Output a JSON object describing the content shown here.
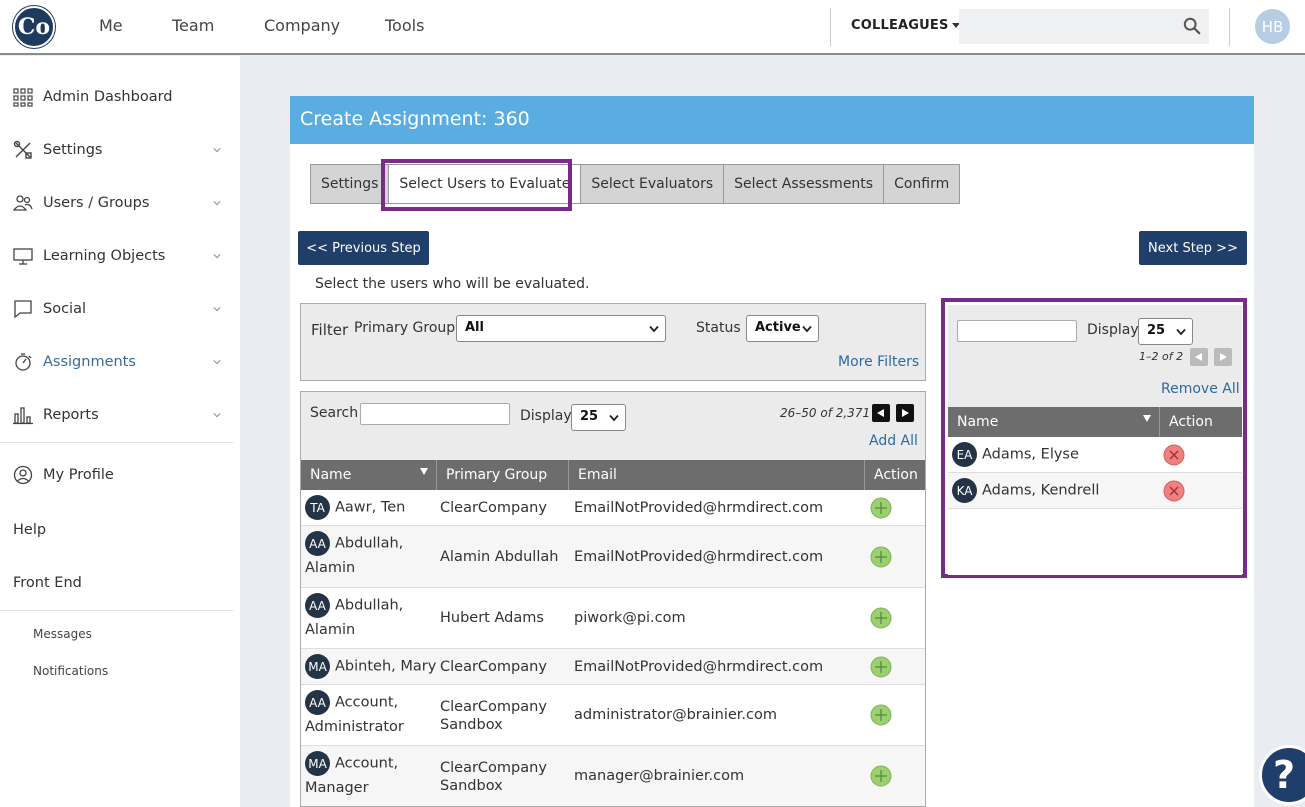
{
  "topnav": {
    "logo_text": "Co",
    "items": [
      "Me",
      "Team",
      "Company",
      "Tools"
    ],
    "colleagues_label": "COLLEAGUES",
    "search_placeholder": "",
    "user_initials": "HB"
  },
  "sidebar": {
    "items": [
      {
        "label": "Admin Dashboard",
        "icon": "grid-icon"
      },
      {
        "label": "Settings",
        "icon": "tools-icon"
      },
      {
        "label": "Users / Groups",
        "icon": "users-icon"
      },
      {
        "label": "Learning Objects",
        "icon": "monitor-icon"
      },
      {
        "label": "Social",
        "icon": "chat-icon"
      },
      {
        "label": "Assignments",
        "icon": "stopwatch-icon"
      },
      {
        "label": "Reports",
        "icon": "bar-chart-icon"
      }
    ],
    "profile_label": "My Profile",
    "help_label": "Help",
    "front_end_label": "Front End",
    "messages_label": "Messages",
    "notifications_label": "Notifications"
  },
  "card": {
    "title": "Create Assignment: 360",
    "tabs": [
      "Settings",
      "Select Users to Evaluate",
      "Select Evaluators",
      "Select Assessments",
      "Confirm"
    ],
    "active_tab": "Select Users to Evaluate",
    "prev_button": "<< Previous Step",
    "next_button": "Next Step >>",
    "instructions": "Select the users who will be evaluated."
  },
  "filter": {
    "label": "Filter",
    "primary_group_label": "Primary Group",
    "primary_group_value": "All",
    "status_label": "Status",
    "status_value": "Active",
    "more_filters": "More Filters"
  },
  "available": {
    "search_label": "Search",
    "display_label": "Display",
    "display_value": "25",
    "pager_text": "26–50 of 2,371",
    "add_all": "Add All",
    "columns": [
      "Name",
      "Primary Group",
      "Email",
      "Action"
    ],
    "rows": [
      {
        "initials": "TA",
        "name": "Aawr, Ten",
        "group": "ClearCompany",
        "email": "EmailNotProvided@hrmdirect.com"
      },
      {
        "initials": "AA",
        "name": "Abdullah, Alamin",
        "group": "Alamin Abdullah",
        "email": "EmailNotProvided@hrmdirect.com"
      },
      {
        "initials": "AA",
        "name": "Abdullah, Alamin",
        "group": "Hubert Adams",
        "email": "piwork@pi.com"
      },
      {
        "initials": "MA",
        "name": "Abinteh, Mary",
        "group": "ClearCompany",
        "email": "EmailNotProvided@hrmdirect.com"
      },
      {
        "initials": "AA",
        "name": "Account, Administrator",
        "group": "ClearCompany Sandbox",
        "email": "administrator@brainier.com"
      },
      {
        "initials": "MA",
        "name": "Account, Manager",
        "group": "ClearCompany Sandbox",
        "email": "manager@brainier.com"
      }
    ]
  },
  "selected": {
    "display_label": "Display",
    "display_value": "25",
    "pager_text": "1–2 of 2",
    "remove_all": "Remove All",
    "columns": [
      "Name",
      "Action"
    ],
    "rows": [
      {
        "initials": "EA",
        "name": "Adams, Elyse"
      },
      {
        "initials": "KA",
        "name": "Adams, Kendrell"
      }
    ]
  },
  "help_button": "?",
  "colors": {
    "header_blue": "#5aade0",
    "button_navy": "#1f3e6a",
    "highlight_purple": "#7a2a8a",
    "add_green": "#9ccf6e",
    "remove_red": "#f08080"
  }
}
